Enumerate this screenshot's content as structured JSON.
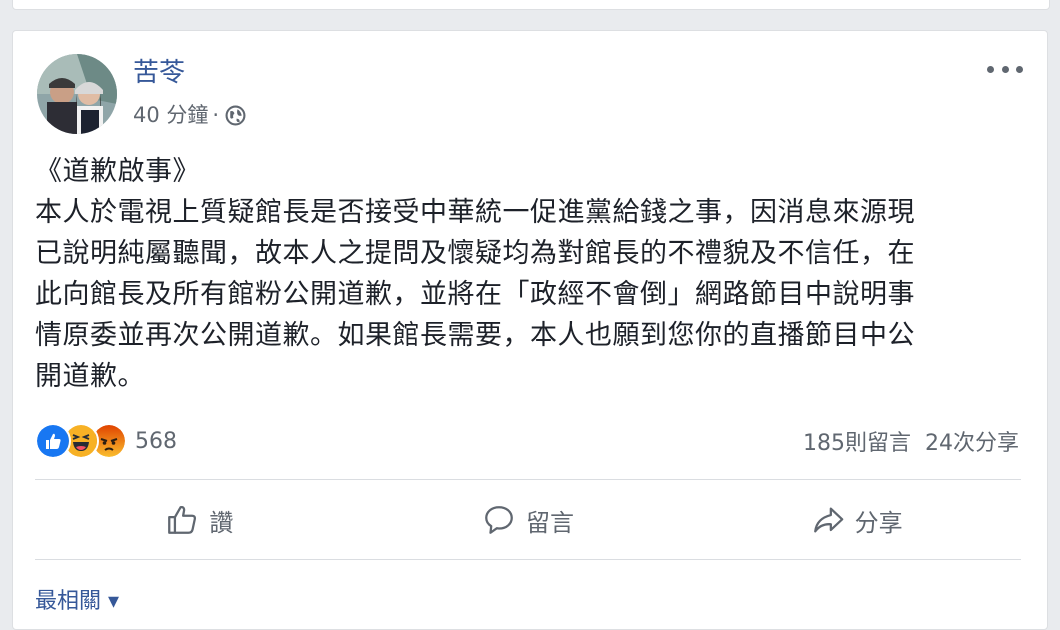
{
  "post": {
    "author": "苦苓",
    "timestamp": "40 分鐘",
    "separator": "·",
    "privacy_icon": "globe-icon",
    "text_lines": [
      "《道歉啟事》",
      "本人於電視上質疑館長是否接受中華統一促進黨給錢之事，因消息來源現",
      "已說明純屬聽聞，故本人之提問及懷疑均為對館長的不禮貌及不信任，在",
      "此向館長及所有館粉公開道歉，並將在「政經不會倒」網路節目中說明事",
      "情原委並再次公開道歉。如果館長需要，本人也願到您你的直播節目中公",
      "開道歉。"
    ]
  },
  "engagement": {
    "reactions": [
      "like-icon",
      "haha-icon",
      "angry-icon"
    ],
    "reaction_count": "568",
    "comments": "185則留言",
    "shares": "24次分享"
  },
  "actions": {
    "like": "讚",
    "comment": "留言",
    "share": "分享"
  },
  "footer": {
    "more_comments": "最相關 ▾"
  },
  "colors": {
    "link": "#365899",
    "text": "#1d2129",
    "muted": "#606770",
    "like_blue": "#1877f2",
    "haha_yellow": "#f7b125",
    "angry_red": "#e9710f"
  }
}
